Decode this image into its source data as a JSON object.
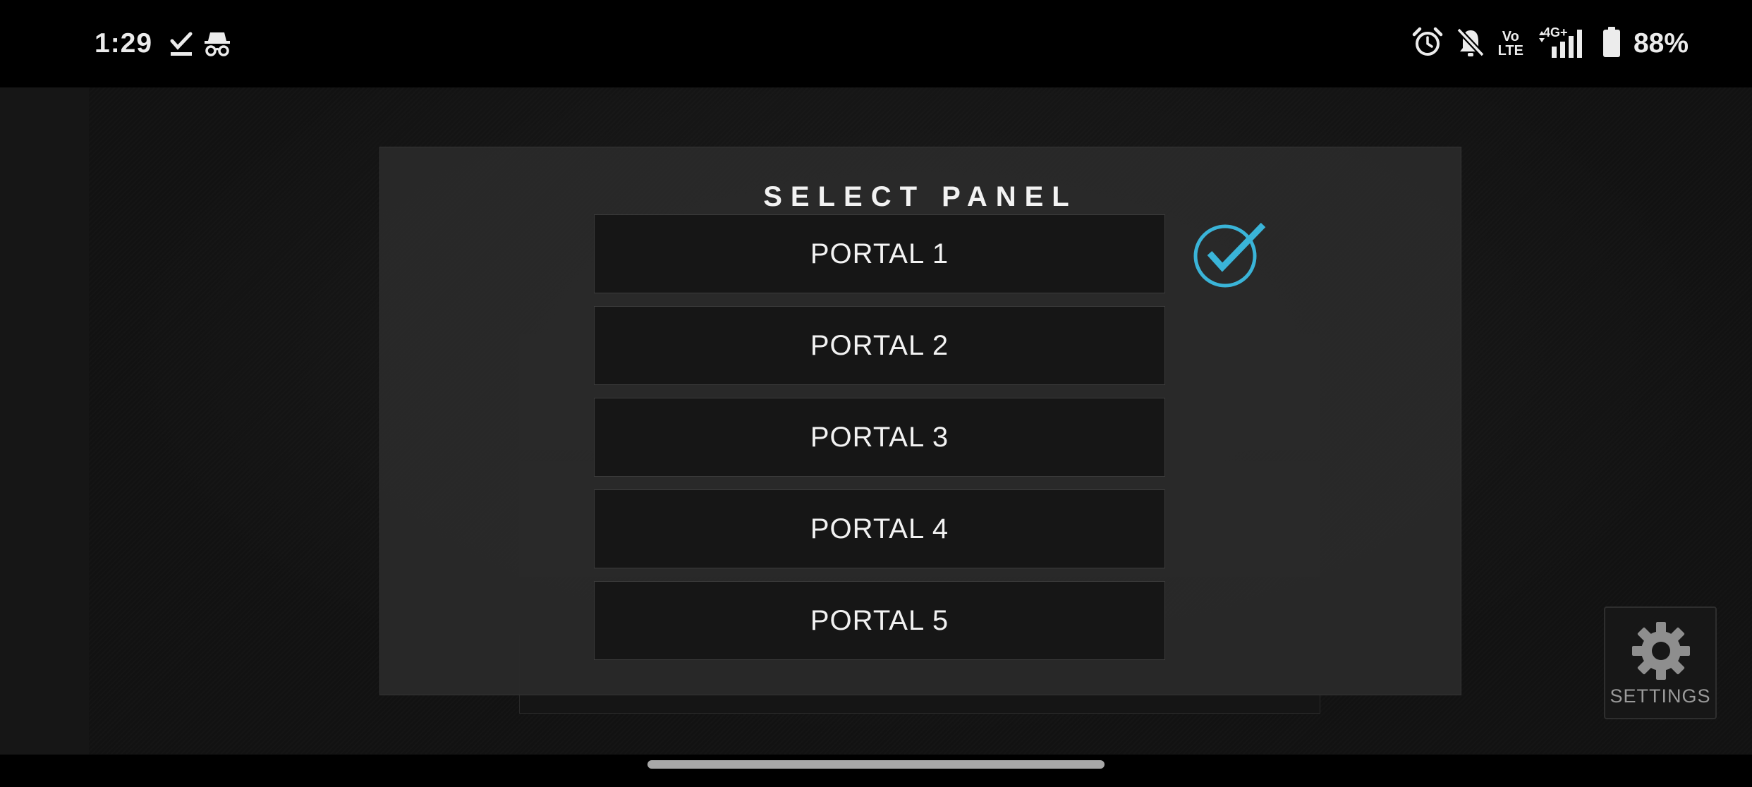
{
  "status_bar": {
    "time": "1:29",
    "battery_percent": "88%",
    "left_icons": [
      "task-done-icon",
      "incognito-icon"
    ],
    "right_icons": [
      "alarm-icon",
      "bell-off-icon",
      "volte-icon",
      "signal-4g-icon",
      "battery-icon"
    ],
    "volte_top": "Vo",
    "volte_bottom": "LTE",
    "network_type": "4G+"
  },
  "modal": {
    "title": "SELECT PANEL",
    "portals": [
      {
        "label": "PORTAL 1",
        "selected": true
      },
      {
        "label": "PORTAL 2",
        "selected": false
      },
      {
        "label": "PORTAL 3",
        "selected": false
      },
      {
        "label": "PORTAL 4",
        "selected": false
      },
      {
        "label": "PORTAL 5",
        "selected": false
      }
    ],
    "check_color": "#3ab4d8"
  },
  "settings": {
    "label": "SETTINGS"
  },
  "colors": {
    "accent": "#3ab4d8",
    "modal_bg": "#2a2a2a",
    "button_bg": "#161616",
    "text": "#f2f2f2"
  }
}
